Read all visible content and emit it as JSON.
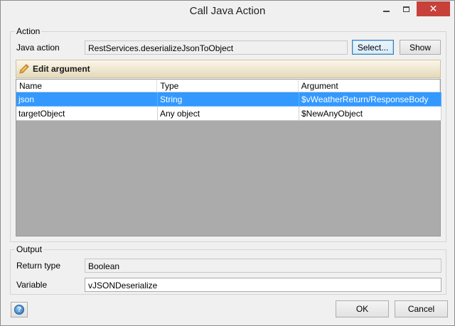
{
  "window": {
    "title": "Call Java Action"
  },
  "action": {
    "group_label": "Action",
    "java_action_label": "Java action",
    "java_action_value": "RestServices.deserializeJsonToObject",
    "select_label": "Select...",
    "show_label": "Show"
  },
  "toolbar": {
    "edit_argument_label": "Edit argument"
  },
  "grid": {
    "columns": [
      "Name",
      "Type",
      "Argument"
    ],
    "rows": [
      {
        "name": "json",
        "type": "String",
        "argument": "$vWeatherReturn/ResponseBody",
        "selected": true
      },
      {
        "name": "targetObject",
        "type": "Any object",
        "argument": "$NewAnyObject",
        "selected": false
      }
    ]
  },
  "output": {
    "group_label": "Output",
    "return_type_label": "Return type",
    "return_type_value": "Boolean",
    "variable_label": "Variable",
    "variable_value": "vJSONDeserialize"
  },
  "footer": {
    "ok_label": "OK",
    "cancel_label": "Cancel"
  },
  "colors": {
    "selection": "#3399ff",
    "close_button": "#c7413a"
  }
}
